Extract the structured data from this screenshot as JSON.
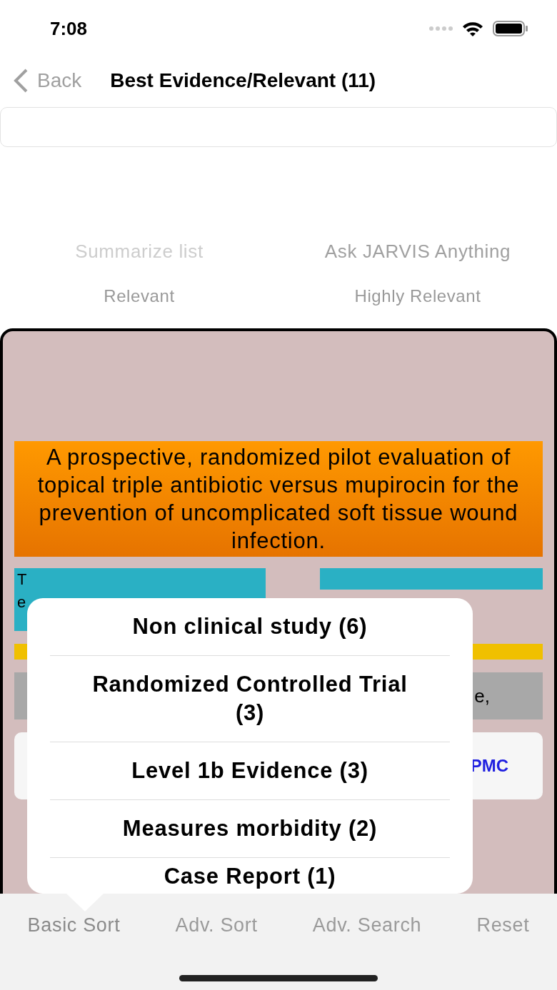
{
  "status_bar": {
    "time": "7:08"
  },
  "nav": {
    "back": "Back",
    "title": "Best Evidence/Relevant (11)"
  },
  "actions": [
    {
      "label": "Summarize list",
      "disabled": true
    },
    {
      "label": "Ask JARVIS Anything",
      "disabled": false
    }
  ],
  "filters": [
    {
      "label": "Relevant"
    },
    {
      "label": "Highly Relevant"
    }
  ],
  "article": {
    "title": "A prospective, randomized pilot evaluation of topical triple antibiotic versus mupirocin for the prevention of uncomplicated soft tissue wound infection.",
    "teal_left": [
      "T",
      "e"
    ],
    "gray": "e,",
    "link": "PMC"
  },
  "popover": {
    "items": [
      "Non clinical study (6)",
      "Randomized Controlled Trial (3)",
      "Level 1b Evidence (3)",
      "Measures morbidity (2)",
      "Case Report (1)"
    ]
  },
  "tab_bar": [
    {
      "label": "Basic Sort",
      "selected": true
    },
    {
      "label": "Adv. Sort",
      "selected": false
    },
    {
      "label": "Adv. Search",
      "selected": false
    },
    {
      "label": "Reset",
      "selected": false
    }
  ]
}
